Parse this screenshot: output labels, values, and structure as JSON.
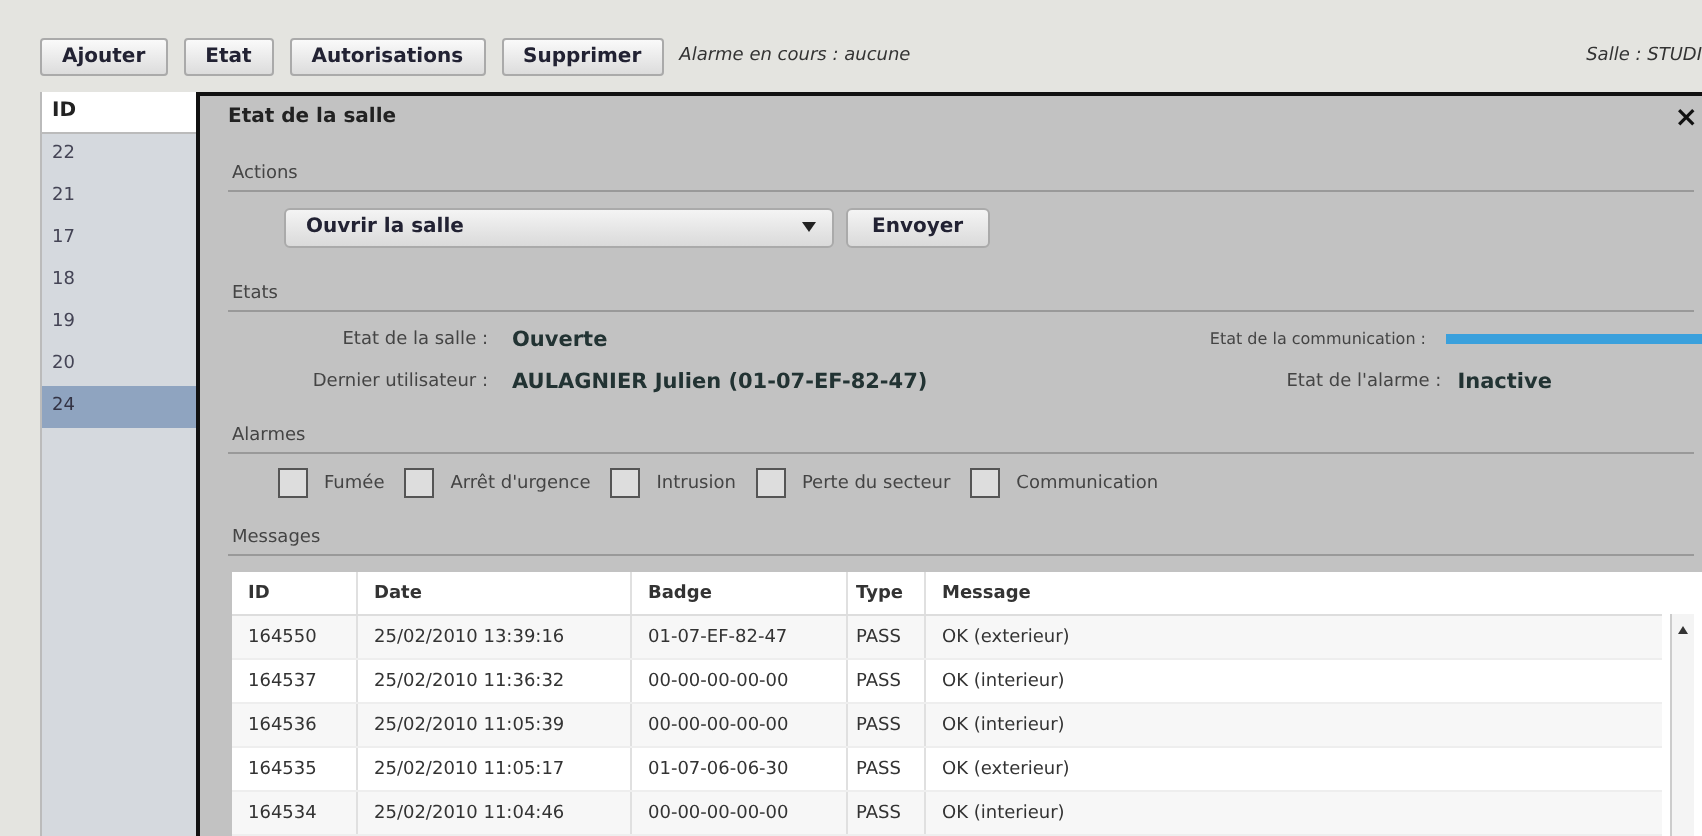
{
  "toolbar": {
    "buttons": [
      "Ajouter",
      "Etat",
      "Autorisations",
      "Supprimer"
    ],
    "alarm_status": "Alarme en cours : aucune",
    "room": "Salle : STUDI"
  },
  "room_list": {
    "header": "ID",
    "items": [
      {
        "label": "22",
        "selected": false
      },
      {
        "label": "21",
        "selected": false
      },
      {
        "label": "17",
        "selected": false
      },
      {
        "label": "18",
        "selected": false
      },
      {
        "label": "19",
        "selected": false
      },
      {
        "label": "20",
        "selected": false
      },
      {
        "label": "24",
        "selected": true
      }
    ]
  },
  "dialog": {
    "title": "Etat de la salle",
    "close": "×",
    "actions": {
      "heading": "Actions",
      "select_value": "Ouvrir la salle",
      "send_button": "Envoyer"
    },
    "states": {
      "heading": "Etats",
      "room_state_label": "Etat de la salle :",
      "room_state": "Ouverte",
      "last_user_label": "Dernier utilisateur :",
      "last_user": "AULAGNIER Julien (01-07-EF-82-47)",
      "communication": {
        "label": "Etat de la communication :",
        "level": 1
      },
      "alarm_state_label": "Etat de l'alarme :",
      "alarm_state": "Inactive"
    },
    "alarms": {
      "heading": "Alarmes",
      "items": [
        {
          "label": "Fumée",
          "checked": false
        },
        {
          "label": "Arrêt d'urgence",
          "checked": false
        },
        {
          "label": "Intrusion",
          "checked": false
        },
        {
          "label": "Perte du secteur",
          "checked": false
        },
        {
          "label": "Communication",
          "checked": false
        }
      ]
    },
    "messages": {
      "heading": "Messages",
      "columns": [
        "ID",
        "Date",
        "Badge",
        "Type",
        "Message"
      ],
      "rows": [
        [
          "164550",
          "25/02/2010 13:39:16",
          "01-07-EF-82-47",
          "PASS",
          "OK (exterieur)"
        ],
        [
          "164537",
          "25/02/2010 11:36:32",
          "00-00-00-00-00",
          "PASS",
          "OK (interieur)"
        ],
        [
          "164536",
          "25/02/2010 11:05:39",
          "00-00-00-00-00",
          "PASS",
          "OK (interieur)"
        ],
        [
          "164535",
          "25/02/2010 11:05:17",
          "01-07-06-06-30",
          "PASS",
          "OK (exterieur)"
        ],
        [
          "164534",
          "25/02/2010 11:04:46",
          "00-00-00-00-00",
          "PASS",
          "OK (interieur)"
        ]
      ]
    }
  }
}
